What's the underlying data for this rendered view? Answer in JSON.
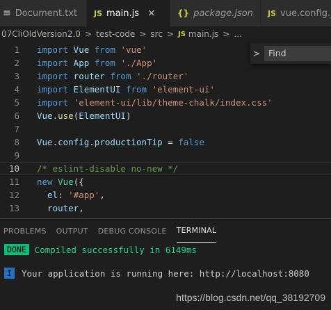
{
  "tabs": [
    {
      "icon": "≡",
      "label": "Document.txt"
    },
    {
      "icon": "JS",
      "label": "main.js",
      "close": "×"
    },
    {
      "icon": "{}",
      "label": "package.json"
    },
    {
      "icon": "JS",
      "label": "vue.config.js"
    }
  ],
  "breadcrumb": {
    "items": [
      "07CliOldVersion2.0",
      "test-code",
      "src",
      "main.js",
      "..."
    ],
    "separator": ">",
    "file_icon": "JS"
  },
  "find": {
    "toggle": ">",
    "placeholder": "Find"
  },
  "editor": {
    "line_numbers": [
      "1",
      "2",
      "3",
      "4",
      "5",
      "6",
      "7",
      "8",
      "9",
      "10",
      "11",
      "12",
      "13"
    ],
    "lines": [
      [
        {
          "t": "import",
          "c": "imp"
        },
        {
          "t": " Vue ",
          "c": "var"
        },
        {
          "t": "from",
          "c": "imp"
        },
        {
          "t": " ",
          "c": "pun"
        },
        {
          "t": "'vue'",
          "c": "str"
        }
      ],
      [
        {
          "t": "import",
          "c": "imp"
        },
        {
          "t": " App ",
          "c": "var"
        },
        {
          "t": "from",
          "c": "imp"
        },
        {
          "t": " ",
          "c": "pun"
        },
        {
          "t": "'./App'",
          "c": "str"
        }
      ],
      [
        {
          "t": "import",
          "c": "imp"
        },
        {
          "t": " router ",
          "c": "var"
        },
        {
          "t": "from",
          "c": "imp"
        },
        {
          "t": " ",
          "c": "pun"
        },
        {
          "t": "'./router'",
          "c": "str"
        }
      ],
      [
        {
          "t": "import",
          "c": "imp"
        },
        {
          "t": " ElementUI ",
          "c": "var"
        },
        {
          "t": "from",
          "c": "imp"
        },
        {
          "t": " ",
          "c": "pun"
        },
        {
          "t": "'element-ui'",
          "c": "str"
        }
      ],
      [
        {
          "t": "import",
          "c": "imp"
        },
        {
          "t": " ",
          "c": "pun"
        },
        {
          "t": "'element-ui/lib/theme-chalk/index.css'",
          "c": "str"
        }
      ],
      [
        {
          "t": "Vue",
          "c": "var"
        },
        {
          "t": ".",
          "c": "pun"
        },
        {
          "t": "use",
          "c": "fn"
        },
        {
          "t": "(",
          "c": "pun"
        },
        {
          "t": "ElementUI",
          "c": "var"
        },
        {
          "t": ")",
          "c": "pun"
        }
      ],
      [],
      [
        {
          "t": "Vue",
          "c": "var"
        },
        {
          "t": ".",
          "c": "pun"
        },
        {
          "t": "config",
          "c": "var"
        },
        {
          "t": ".",
          "c": "pun"
        },
        {
          "t": "productionTip",
          "c": "var"
        },
        {
          "t": " = ",
          "c": "pun"
        },
        {
          "t": "false",
          "c": "kw"
        }
      ],
      [],
      [
        {
          "t": "/* eslint-disable no-new */",
          "c": "com"
        }
      ],
      [
        {
          "t": "new",
          "c": "kw"
        },
        {
          "t": " ",
          "c": "pun"
        },
        {
          "t": "Vue",
          "c": "cls"
        },
        {
          "t": "({",
          "c": "pun"
        }
      ],
      [
        {
          "t": "  el",
          "c": "var"
        },
        {
          "t": ": ",
          "c": "pun"
        },
        {
          "t": "'#app'",
          "c": "str"
        },
        {
          "t": ",",
          "c": "pun"
        }
      ],
      [
        {
          "t": "  router",
          "c": "var"
        },
        {
          "t": ",",
          "c": "pun"
        }
      ]
    ],
    "active_line": 9
  },
  "panel": {
    "tabs": [
      "PROBLEMS",
      "OUTPUT",
      "DEBUG CONSOLE",
      "TERMINAL"
    ],
    "active_tab": "TERMINAL",
    "done_badge": "DONE",
    "compiled_msg": "Compiled successfully in 6149ms",
    "info_badge": "I",
    "running_msg": "Your application is running here: http://localhost:8080"
  },
  "watermark": "https://blog.csdn.net/qq_38192709"
}
